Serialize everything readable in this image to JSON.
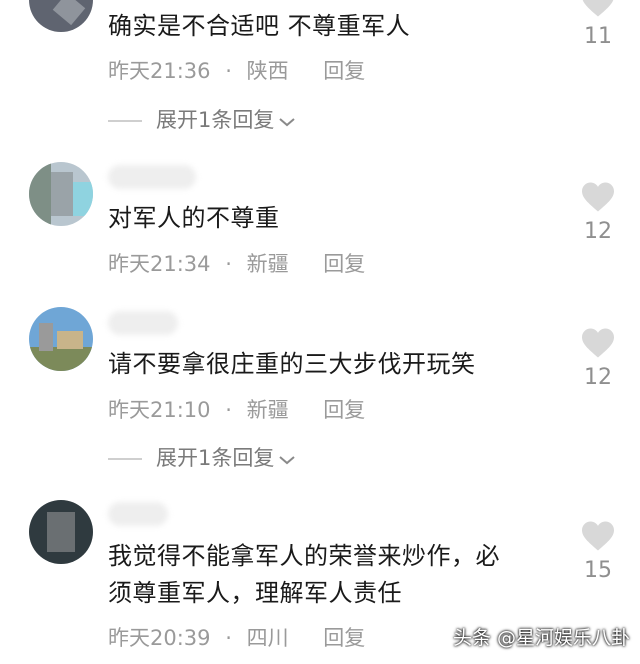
{
  "comments": [
    {
      "text_lines": [
        "确实是不合适吧  不尊重军人"
      ],
      "time": "昨天21:36",
      "location": "陕西",
      "reply_label": "回复",
      "likes": "11",
      "expand_label": "展开1条回复"
    },
    {
      "text_lines": [
        "对军人的不尊重"
      ],
      "time": "昨天21:34",
      "location": "新疆",
      "reply_label": "回复",
      "likes": "12"
    },
    {
      "text_lines": [
        "请不要拿很庄重的三大步伐开玩笑"
      ],
      "time": "昨天21:10",
      "location": "新疆",
      "reply_label": "回复",
      "likes": "12",
      "expand_label": "展开1条回复"
    },
    {
      "text_lines": [
        "我觉得不能拿军人的荣誉来炒作，必",
        "须尊重军人，理解军人责任"
      ],
      "time": "昨天20:39",
      "location": "四川",
      "reply_label": "回复",
      "likes": "15"
    }
  ],
  "separator": "·",
  "watermark": "头条 @星河娱乐八卦",
  "icons": {
    "like": "heart-icon",
    "expand": "chevron-down-icon"
  },
  "colors": {
    "heart": "#d8d8d8",
    "meta_text": "#9a9a9a",
    "body_text": "#1a1a1a"
  }
}
